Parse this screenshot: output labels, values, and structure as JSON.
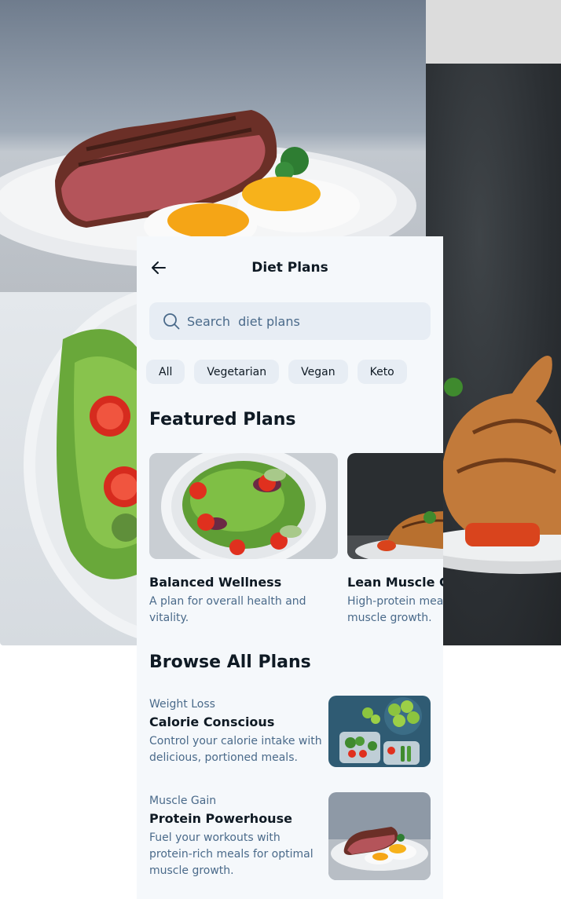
{
  "header": {
    "title": "Diet Plans",
    "back_icon": "arrow-left-icon"
  },
  "search": {
    "placeholder": "Search  diet plans",
    "icon": "search-icon"
  },
  "filters": [
    "All",
    "Vegetarian",
    "Vegan",
    "Keto"
  ],
  "featured": {
    "heading": "Featured Plans",
    "cards": [
      {
        "title": "Balanced Wellness",
        "description": "A plan for overall health and vitality.",
        "image": "salad-bowl"
      },
      {
        "title": "Lean Muscle Gain",
        "description": "High-protein meals for muscle growth.",
        "image": "grilled-chicken"
      }
    ]
  },
  "browse": {
    "heading": "Browse All Plans",
    "items": [
      {
        "category": "Weight Loss",
        "title": "Calorie Conscious",
        "description": "Control your calorie intake with delicious, portioned meals.",
        "image": "meal-prep-containers"
      },
      {
        "category": "Muscle Gain",
        "title": "Protein Powerhouse",
        "description": "Fuel your workouts with protein-rich meals for optimal muscle growth.",
        "image": "steak-and-eggs"
      }
    ]
  },
  "colors": {
    "background": "#f5f8fb",
    "chip": "#e7edf4",
    "text_primary": "#0f1a24",
    "text_secondary": "#4a6a8a"
  }
}
